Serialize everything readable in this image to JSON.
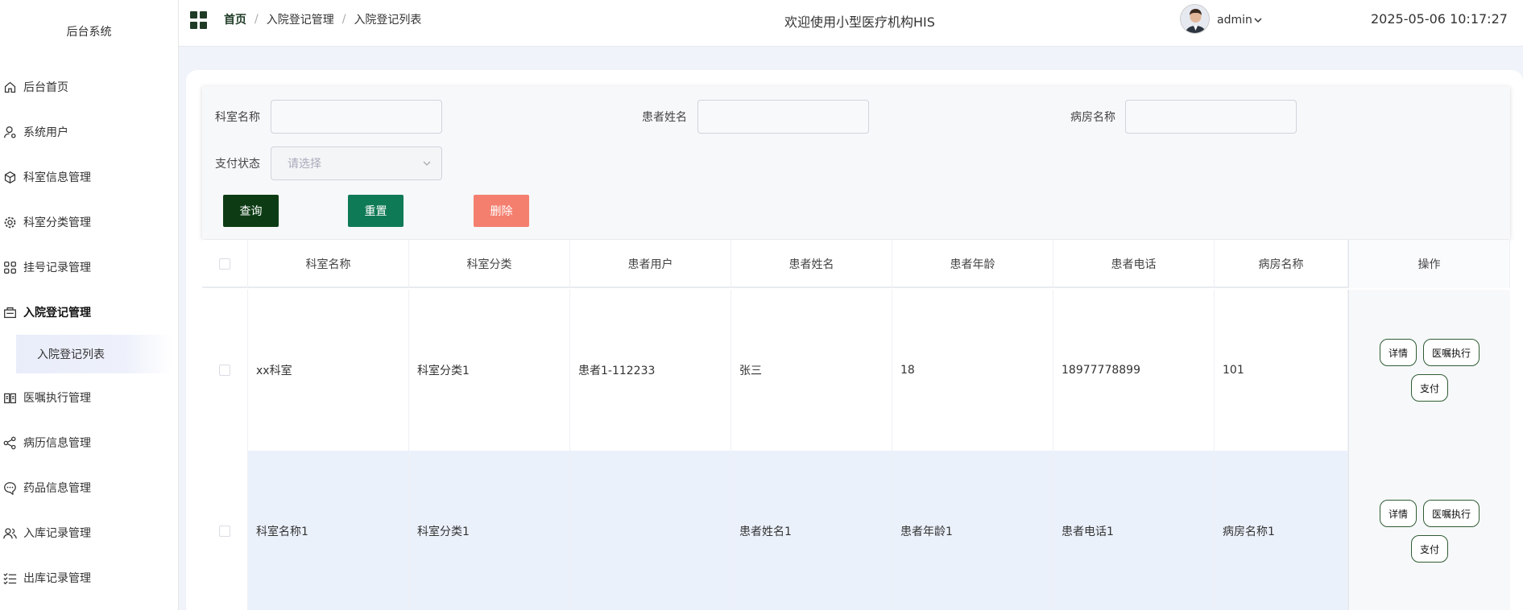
{
  "sidebar": {
    "brand": "后台系统",
    "items": [
      {
        "label": "后台首页",
        "icon": "home-icon"
      },
      {
        "label": "系统用户",
        "icon": "user-settings-icon"
      },
      {
        "label": "科室信息管理",
        "icon": "cube-icon"
      },
      {
        "label": "科室分类管理",
        "icon": "gear-icon"
      },
      {
        "label": "挂号记录管理",
        "icon": "grid-icon"
      },
      {
        "label": "入院登记管理",
        "icon": "inbox-icon"
      },
      {
        "label": "医嘱执行管理",
        "icon": "book-icon"
      },
      {
        "label": "病历信息管理",
        "icon": "share-icon"
      },
      {
        "label": "药品信息管理",
        "icon": "chat-icon"
      },
      {
        "label": "入库记录管理",
        "icon": "users-icon"
      },
      {
        "label": "出库记录管理",
        "icon": "checklist-icon"
      }
    ],
    "sub_item": "入院登记列表"
  },
  "header": {
    "breadcrumbs": [
      "首页",
      "入院登记管理",
      "入院登记列表"
    ],
    "welcome": "欢迎使用小型医疗机构HIS",
    "username": "admin",
    "datetime": "2025-05-06 10:17:27"
  },
  "search": {
    "fields": [
      {
        "label": "科室名称",
        "value": ""
      },
      {
        "label": "患者姓名",
        "value": ""
      },
      {
        "label": "病房名称",
        "value": ""
      }
    ],
    "pay_status": {
      "label": "支付状态",
      "placeholder": "请选择"
    },
    "buttons": {
      "query": "查询",
      "reset": "重置",
      "delete": "删除"
    }
  },
  "table": {
    "columns": [
      "科室名称",
      "科室分类",
      "患者用户",
      "患者姓名",
      "患者年龄",
      "患者电话",
      "病房名称",
      "操作"
    ],
    "rows": [
      [
        "xx科室",
        "科室分类1",
        "患者1-112233",
        "张三",
        "18",
        "18977778899",
        "101"
      ],
      [
        "科室名称1",
        "科室分类1",
        "",
        "患者姓名1",
        "患者年龄1",
        "患者电话1",
        "病房名称1"
      ]
    ],
    "actions": [
      "详情",
      "医嘱执行",
      "支付"
    ]
  },
  "colors": {
    "query_btn": "#0d3c14",
    "reset_btn": "#0f7a56",
    "delete_btn": "#f47f6f",
    "highlight_row": "#ebf1fb"
  }
}
